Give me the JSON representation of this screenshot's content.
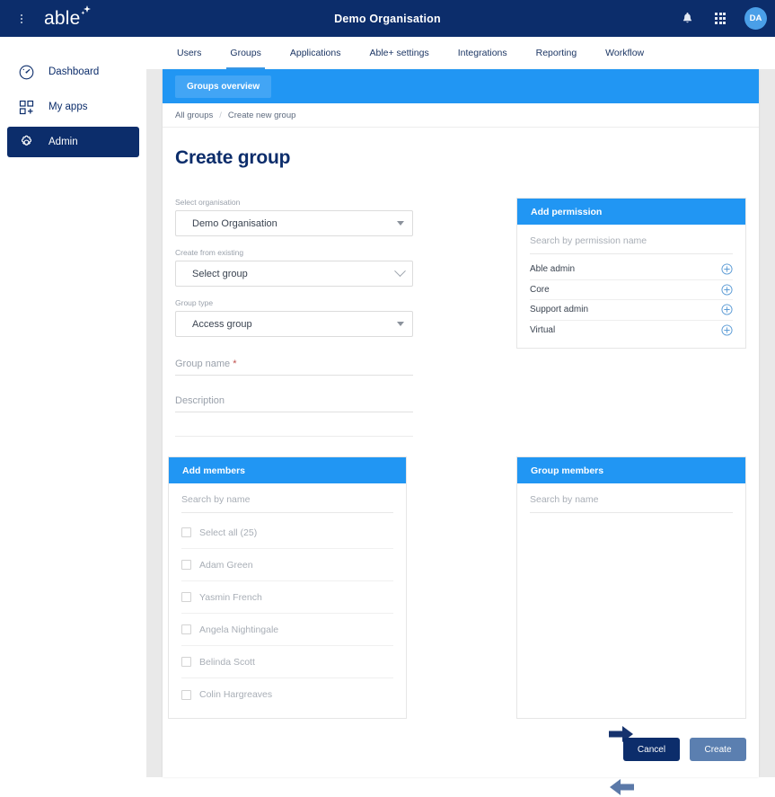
{
  "header": {
    "menu_icon": "kebab-menu-icon",
    "logo_text": "able",
    "title": "Demo Organisation",
    "notifications_icon": "bell-icon",
    "apps_icon": "grid-apps-icon",
    "avatar_initials": "DA"
  },
  "sidebar": {
    "items": [
      {
        "label": "Dashboard",
        "icon": "gauge-icon",
        "active": false
      },
      {
        "label": "My apps",
        "icon": "apps-grid-plus-icon",
        "active": false
      },
      {
        "label": "Admin",
        "icon": "gear-icon",
        "active": true
      }
    ]
  },
  "tabs": [
    {
      "label": "Users",
      "active": false
    },
    {
      "label": "Groups",
      "active": true
    },
    {
      "label": "Applications",
      "active": false
    },
    {
      "label": "Able+ settings",
      "active": false
    },
    {
      "label": "Integrations",
      "active": false
    },
    {
      "label": "Reporting",
      "active": false
    },
    {
      "label": "Workflow",
      "active": false
    }
  ],
  "banner": {
    "button_label": "Groups overview"
  },
  "breadcrumb": {
    "root": "All groups",
    "separator": "/",
    "current": "Create new group"
  },
  "page": {
    "title": "Create group"
  },
  "form": {
    "organisation": {
      "label": "Select organisation",
      "value": "Demo Organisation",
      "icon": "triangle-down-icon"
    },
    "create_from_existing": {
      "label": "Create from existing",
      "value": "Select group",
      "icon": "chevron-down-icon"
    },
    "group_type": {
      "label": "Group type",
      "value": "Access group",
      "icon": "triangle-down-icon"
    },
    "group_name": {
      "label": "Group name",
      "required_marker": "*",
      "value": ""
    },
    "description": {
      "label": "Description",
      "value": ""
    }
  },
  "add_permission": {
    "title": "Add permission",
    "search_placeholder": "Search by permission name",
    "rows": [
      {
        "name": "Able admin",
        "action_icon": "circle-plus-icon"
      },
      {
        "name": "Core",
        "action_icon": "circle-plus-icon"
      },
      {
        "name": "Support admin",
        "action_icon": "circle-plus-icon"
      },
      {
        "name": "Virtual",
        "action_icon": "circle-plus-icon"
      }
    ]
  },
  "add_members": {
    "title": "Add members",
    "search_placeholder": "Search by name",
    "rows": [
      {
        "label": "Select all (25)",
        "checked": false
      },
      {
        "label": "Adam Green",
        "checked": false
      },
      {
        "label": "Yasmin French",
        "checked": false
      },
      {
        "label": "Angela Nightingale",
        "checked": false
      },
      {
        "label": "Belinda Scott",
        "checked": false
      },
      {
        "label": "Colin Hargreaves",
        "checked": false
      }
    ]
  },
  "group_members": {
    "title": "Group members",
    "search_placeholder": "Search by name",
    "rows": []
  },
  "transfer": {
    "add_icon": "arrow-right-icon",
    "remove_icon": "arrow-left-icon"
  },
  "footer": {
    "cancel_label": "Cancel",
    "create_label": "Create"
  },
  "colors": {
    "navy": "#0c2d6b",
    "accent_blue": "#2196f3",
    "banner_button": "#42a5f5",
    "tab_underline": "#3a9ae8",
    "avatar": "#4a9fe8",
    "create_disabled": "#5b7fb0",
    "required": "#c0504d",
    "page_bg": "#e9e9e9"
  }
}
